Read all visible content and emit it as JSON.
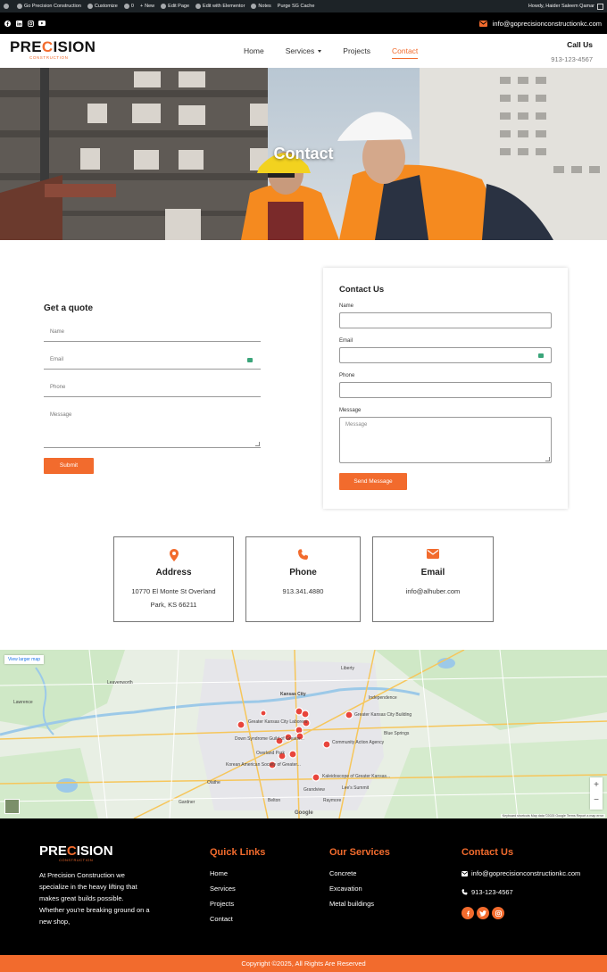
{
  "admin_bar": {
    "site": "Go Precision Construction",
    "customize": "Customize",
    "comments": "0",
    "new": "New",
    "edit_page": "Edit Page",
    "elementor": "Edit with Elementor",
    "notes": "Notes",
    "purge": "Purge SG Cache",
    "howdy": "Howdy, Haider Saleem Qamar"
  },
  "topbar": {
    "social_icons": [
      "facebook-icon",
      "linkedin-icon",
      "instagram-icon",
      "youtube-icon"
    ],
    "email": "info@goprecisionconstructionkc.com"
  },
  "header": {
    "logo_text_a": "PRE",
    "logo_text_c": "C",
    "logo_text_b": "ISION",
    "logo_sub": "CONSTRUCTION",
    "nav": [
      "Home",
      "Services",
      "Projects",
      "Contact"
    ],
    "active_nav": "Contact",
    "call_title": "Call Us",
    "call_number": "913-123-4567"
  },
  "hero": {
    "title": "Contact"
  },
  "quote_form": {
    "heading": "Get a quote",
    "name_placeholder": "Name",
    "email_placeholder": "Email",
    "phone_placeholder": "Phone",
    "message_placeholder": "Message",
    "submit": "Submit"
  },
  "contact_form": {
    "heading": "Contact Us",
    "name_label": "Name",
    "email_label": "Email",
    "phone_label": "Phone",
    "message_label": "Message",
    "message_placeholder": "Message",
    "send": "Send Message"
  },
  "info": {
    "address_title": "Address",
    "address_line1": "10770 El Monte St Overland",
    "address_line2": "Park, KS 66211",
    "phone_title": "Phone",
    "phone_value": "913.341.4880",
    "email_title": "Email",
    "email_value": "info@alhuber.com"
  },
  "map": {
    "view_larger": "View larger map",
    "labels": [
      "Greater Kansas City Laborers",
      "Greater Kansas City Building",
      "Down Syndrome Guild of Greater...",
      "Community Action Agency",
      "Korean American Society of Greater...",
      "Kaleidoscope of Greater Kansas...",
      "Kansas City",
      "Overland Park",
      "Lee's Summit",
      "Olathe",
      "Leavenworth",
      "Liberty",
      "Independence",
      "Blue Springs",
      "Lawrence",
      "Gardner",
      "Belton",
      "Raymore",
      "Grandview"
    ],
    "zoom_in": "+",
    "zoom_out": "−",
    "attribution": "Keyboard shortcuts   Map data ©2025 Google   Terms   Report a map error",
    "google": "Google"
  },
  "footer": {
    "logo_text_a": "PRE",
    "logo_text_c": "C",
    "logo_text_b": "ISION",
    "logo_sub": "CONSTRUCTION",
    "about": "At Precision Construction we specialize in the heavy lifting that makes great builds possible. Whether you're breaking ground on a new shop,",
    "quick_links_title": "Quick Links",
    "quick_links": [
      "Home",
      "Services",
      "Projects",
      "Contact"
    ],
    "services_title": "Our Services",
    "services": [
      "Concrete",
      "Excavation",
      "Metal buildings"
    ],
    "contact_title": "Contact Us",
    "email": "info@goprecisionconstructionkc.com",
    "phone": "913-123-4567",
    "social": [
      "facebook-icon",
      "twitter-icon",
      "instagram-icon"
    ],
    "copyright": "Copyright ©2025, All Rights Are Reserved"
  },
  "colors": {
    "accent": "#f26b2d",
    "dark": "#000000",
    "adminbar": "#1d2327"
  }
}
